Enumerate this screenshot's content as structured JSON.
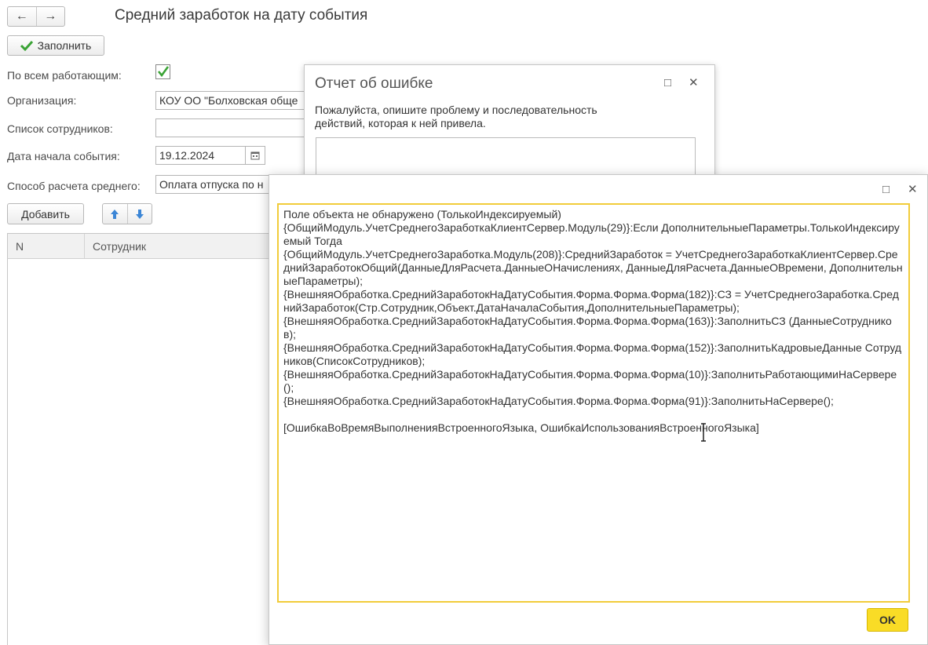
{
  "nav": {
    "back_icon": "←",
    "forward_icon": "→"
  },
  "form": {
    "title": "Средний заработок на дату события",
    "fill_button": "Заполнить",
    "all_working_label": "По всем работающим:",
    "all_working_checked": true,
    "organization_label": "Организация:",
    "organization_value": "КОУ ОО \"Болховская обще",
    "employee_list_label": "Список сотрудников:",
    "employee_list_value": "",
    "event_date_label": "Дата начала события:",
    "event_date_value": "19.12.2024",
    "calc_method_label": "Способ расчета среднего:",
    "calc_method_value": "Оплата отпуска по н",
    "add_button": "Добавить",
    "table_columns": [
      "N",
      "Сотрудник"
    ]
  },
  "error_report": {
    "title": "Отчет об ошибке",
    "description": "Пожалуйста, опишите проблему и последовательность действий, которая к ней привела.",
    "maximize_icon": "□",
    "close_icon": "✕"
  },
  "message_dialog": {
    "maximize_icon": "□",
    "close_icon": "✕",
    "text": "Поле объекта не обнаружено (ТолькоИндексируемый)\n{ОбщийМодуль.УчетСреднегоЗаработкаКлиентСервер.Модуль(29)}:Если ДополнительныеПараметры.ТолькоИндексируемый Тогда\n{ОбщийМодуль.УчетСреднегоЗаработка.Модуль(208)}:СреднийЗаработок = УчетСреднегоЗаработкаКлиентСервер.СреднийЗаработокОбщий(ДанныеДляРасчета.ДанныеОНачислениях, ДанныеДляРасчета.ДанныеОВремени, ДополнительныеПараметры);\n{ВнешняяОбработка.СреднийЗаработокНаДатуСобытия.Форма.Форма.Форма(182)}:СЗ = УчетСреднегоЗаработка.СреднийЗаработок(Стр.Сотрудник,Объект.ДатаНачалаСобытия,ДополнительныеПараметры);\n{ВнешняяОбработка.СреднийЗаработокНаДатуСобытия.Форма.Форма.Форма(163)}:ЗаполнитьСЗ (ДанныеСотрудников);\n{ВнешняяОбработка.СреднийЗаработокНаДатуСобытия.Форма.Форма.Форма(152)}:ЗаполнитьКадровыеДанные Сотрудников(СписокСотрудников);\n{ВнешняяОбработка.СреднийЗаработокНаДатуСобытия.Форма.Форма.Форма(10)}:ЗаполнитьРаботающимиНаСервере();\n{ВнешняяОбработка.СреднийЗаработокНаДатуСобытия.Форма.Форма.Форма(91)}:ЗаполнитьНаСервере();\n\n[ОшибкаВоВремяВыполненияВстроенногоЯзыка, ОшибкаИспользованияВстроенногоЯзыка]",
    "ok_button": "OK"
  },
  "colors": {
    "accent_yellow": "#f9dc26",
    "check_green": "#3aa335",
    "arrow_blue": "#3c86d6"
  }
}
